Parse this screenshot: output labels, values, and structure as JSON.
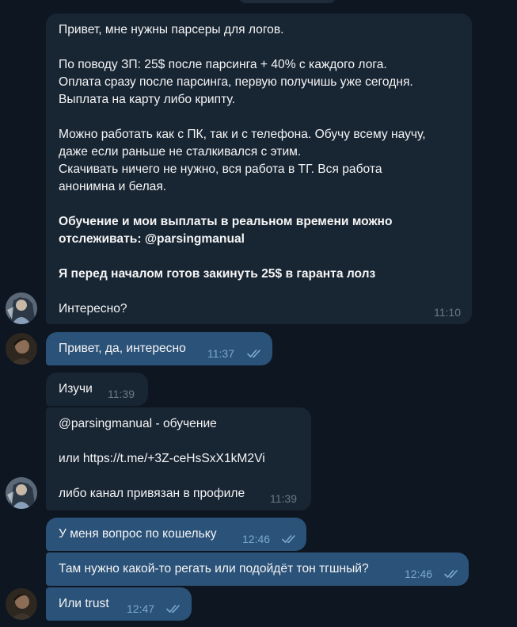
{
  "chat": {
    "messages": [
      {
        "direction": "incoming",
        "blocks": [
          {
            "text": "Привет, мне нужны парсеры для логов.",
            "bold": false
          },
          {
            "text": "По поводу ЗП: 25$ после парсинга + 40% с каждого лога.",
            "bold": false
          },
          {
            "text": "Оплата сразу после парсинга, первую получишь уже сегодня.",
            "bold": false
          },
          {
            "text": "Выплата на карту либо крипту.",
            "bold": false
          },
          {
            "text": "Можно работать как с ПК, так и с телефона. Обучу всему научу,",
            "bold": false
          },
          {
            "text": "даже если раньше не сталкивался с этим.",
            "bold": false
          },
          {
            "text": "Скачивать ничего не нужно, вся работа в ТГ. Вся работа",
            "bold": false
          },
          {
            "text": "анонимна и белая.",
            "bold": false
          },
          {
            "text": "Обучение и мои выплаты в реальном времени можно",
            "bold": true
          },
          {
            "text": "отслеживать: @parsingmanual",
            "bold": true
          },
          {
            "text": "Я перед началом готов закинуть 25$ в гаранта лолз",
            "bold": true
          },
          {
            "text": "Интересно?",
            "bold": false
          }
        ],
        "time": "11:10"
      },
      {
        "direction": "outgoing",
        "text": "Привет, да, интересно",
        "time": "11:37",
        "status": "read"
      },
      {
        "direction": "incoming",
        "text": "Изучи",
        "time": "11:39"
      },
      {
        "direction": "incoming",
        "lines": [
          "@parsingmanual - обучение",
          "или https://t.me/+3Z-ceHsSxX1kM2Vi",
          "либо канал привязан в профиле"
        ],
        "time": "11:39"
      },
      {
        "direction": "outgoing",
        "text": "У меня вопрос по кошельку",
        "time": "12:46",
        "status": "read"
      },
      {
        "direction": "outgoing",
        "text": "Там нужно какой-то регать или подойдёт тон тгшный?",
        "time": "12:46",
        "status": "read"
      },
      {
        "direction": "outgoing",
        "text": "Или trust",
        "time": "12:47",
        "status": "read"
      }
    ]
  },
  "colors": {
    "background": "#0e1621",
    "incoming_bubble": "#182533",
    "outgoing_bubble": "#2b5278",
    "incoming_time": "#6c7883",
    "outgoing_time": "#7da8d3",
    "read_ticks": "#7da8d3"
  },
  "icons": {
    "read_status": "double-check-icon",
    "contact_avatar": "avatar-icon",
    "own_avatar": "avatar-icon"
  }
}
